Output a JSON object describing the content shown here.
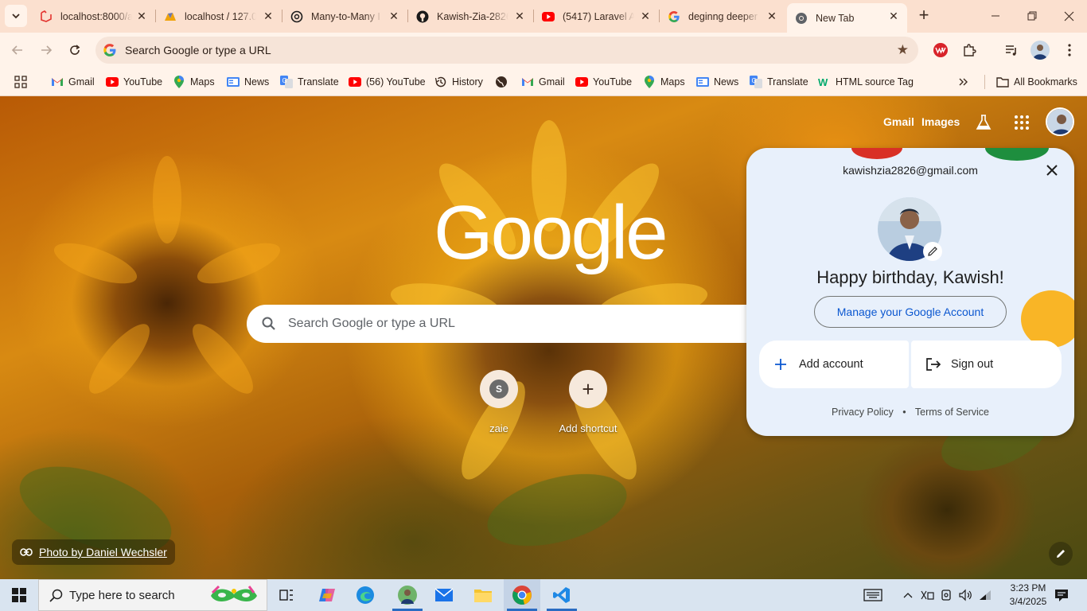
{
  "browser": {
    "tabs": [
      {
        "title": "localhost:8000/a",
        "icon": "laravel-icon"
      },
      {
        "title": "localhost / 127.0",
        "icon": "phpmyadmin-icon"
      },
      {
        "title": "Many-to-Many I",
        "icon": "openai-icon"
      },
      {
        "title": "Kawish-Zia-2826",
        "icon": "github-icon"
      },
      {
        "title": "(5417) Laravel A",
        "icon": "youtube-icon"
      },
      {
        "title": "deginng deeper",
        "icon": "google-icon"
      },
      {
        "title": "New Tab",
        "icon": "chrome-icon",
        "active": true
      }
    ],
    "omnibox_placeholder": "Search Google or type a URL",
    "bookmarks": [
      {
        "label": "Gmail",
        "icon": "gmail-icon"
      },
      {
        "label": "YouTube",
        "icon": "youtube-icon"
      },
      {
        "label": "Maps",
        "icon": "maps-icon"
      },
      {
        "label": "News",
        "icon": "news-icon"
      },
      {
        "label": "Translate",
        "icon": "translate-icon"
      },
      {
        "label": "(56) YouTube",
        "icon": "youtube-icon"
      },
      {
        "label": "History",
        "icon": "history-icon"
      },
      {
        "label": "",
        "icon": "globe-icon"
      },
      {
        "label": "Gmail",
        "icon": "gmail-icon"
      },
      {
        "label": "YouTube",
        "icon": "youtube-icon"
      },
      {
        "label": "Maps",
        "icon": "maps-icon"
      },
      {
        "label": "News",
        "icon": "news-icon"
      },
      {
        "label": "Translate",
        "icon": "translate-icon"
      },
      {
        "label": "HTML source Tag",
        "icon": "w3schools-icon"
      }
    ],
    "all_bookmarks_label": "All Bookmarks"
  },
  "ntp": {
    "top_links": {
      "gmail": "Gmail",
      "images": "Images"
    },
    "logo_text": "Google",
    "search_placeholder": "Search Google or type a URL",
    "shortcuts": [
      {
        "label": "zaie",
        "initial": "S"
      },
      {
        "label": "Add shortcut",
        "initial": "+"
      }
    ],
    "photo_credit": "Photo by Daniel Wechsler"
  },
  "account_popup": {
    "email": "kawishzia2826@gmail.com",
    "greeting": "Happy birthday, Kawish!",
    "manage_label": "Manage your Google Account",
    "add_account_label": "Add account",
    "sign_out_label": "Sign out",
    "privacy_label": "Privacy Policy",
    "separator": "•",
    "terms_label": "Terms of Service"
  },
  "taskbar": {
    "search_placeholder": "Type here to search",
    "time": "3:23 PM",
    "date": "3/4/2025"
  },
  "colors": {
    "tab_bg": "#fbe0cf",
    "toolbar_bg": "#fff3ea",
    "popup_bg": "#e8f0fb",
    "link_blue": "#0b57d0",
    "taskbar_bg": "#d9e4f0"
  }
}
